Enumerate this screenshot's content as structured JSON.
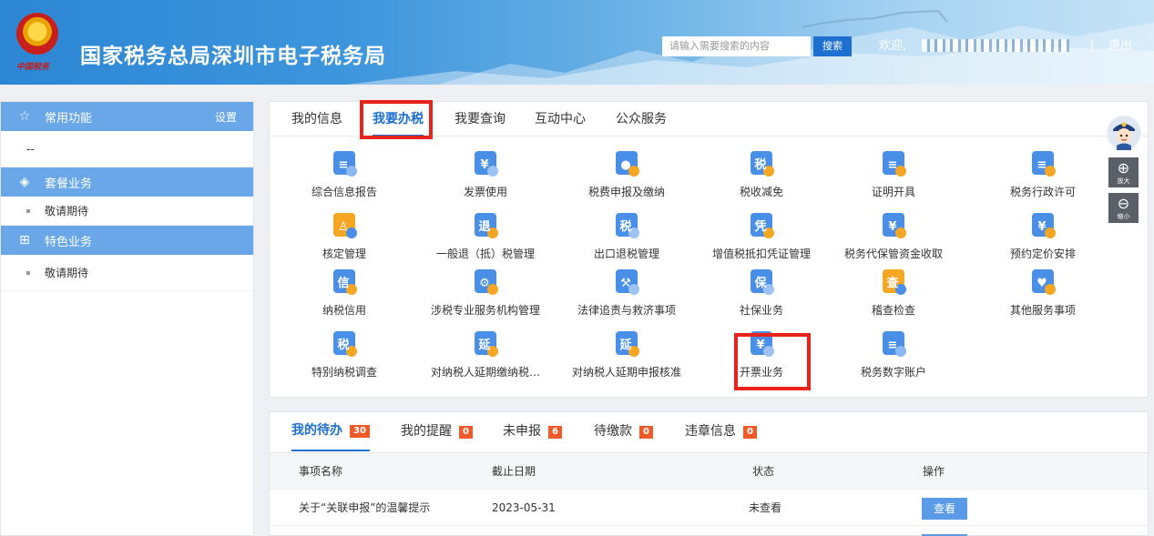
{
  "header": {
    "emblem_text": "中国税务",
    "title": "国家税务总局深圳市电子税务局",
    "search_placeholder": "请输入需要搜索的内容",
    "search_button": "搜索",
    "welcome": "欢迎,",
    "separator": "|",
    "logout": "退出"
  },
  "sidebar": {
    "sections": [
      {
        "icon": "star-icon",
        "title": "常用功能",
        "settings": "设置",
        "items": [
          "--"
        ]
      },
      {
        "icon": "layers-icon",
        "title": "套餐业务",
        "items": [
          "敬请期待"
        ]
      },
      {
        "icon": "grid-icon",
        "title": "特色业务",
        "items": [
          "敬请期待"
        ]
      }
    ]
  },
  "main_tabs": [
    "我的信息",
    "我要办税",
    "我要查询",
    "互动中心",
    "公众服务"
  ],
  "active_tab": "我要办税",
  "services": [
    {
      "label": "综合信息报告",
      "icon": "document-icon"
    },
    {
      "label": "发票使用",
      "icon": "invoice-yen-icon"
    },
    {
      "label": "税费申报及缴纳",
      "icon": "hand-coin-icon"
    },
    {
      "label": "税收减免",
      "icon": "tax-minus-icon"
    },
    {
      "label": "证明开具",
      "icon": "certificate-icon"
    },
    {
      "label": "税务行政许可",
      "icon": "license-award-icon"
    },
    {
      "label": "核定管理",
      "icon": "stamp-icon"
    },
    {
      "label": "一般退（抵）税管理",
      "icon": "refund-icon"
    },
    {
      "label": "出口退税管理",
      "icon": "export-refund-icon"
    },
    {
      "label": "增值税抵扣凭证管理",
      "icon": "voucher-icon"
    },
    {
      "label": "税务代保管资金收取",
      "icon": "fund-custody-icon"
    },
    {
      "label": "预约定价安排",
      "icon": "calendar-yen-icon"
    },
    {
      "label": "纳税信用",
      "icon": "credit-medal-icon"
    },
    {
      "label": "涉税专业服务机构管理",
      "icon": "building-gear-icon"
    },
    {
      "label": "法律追责与救济事项",
      "icon": "gavel-icon"
    },
    {
      "label": "社保业务",
      "icon": "social-insurance-icon"
    },
    {
      "label": "稽查检查",
      "icon": "inspection-shield-icon"
    },
    {
      "label": "其他服务事项",
      "icon": "heart-hands-icon"
    },
    {
      "label": "特别纳税调查",
      "icon": "special-tax-icon"
    },
    {
      "label": "对纳税人延期缴纳税…",
      "icon": "deferred-payment-icon"
    },
    {
      "label": "对纳税人延期申报核准",
      "icon": "deferred-filing-icon"
    },
    {
      "label": "开票业务",
      "icon": "invoicing-yen-icon"
    },
    {
      "label": "税务数字账户",
      "icon": "digital-account-icon"
    }
  ],
  "todo_tabs": [
    {
      "label": "我的待办",
      "count": "30"
    },
    {
      "label": "我的提醒",
      "count": "0"
    },
    {
      "label": "未申报",
      "count": "6"
    },
    {
      "label": "待缴款",
      "count": "0"
    },
    {
      "label": "违章信息",
      "count": "0"
    }
  ],
  "todo_table": {
    "columns": [
      "事项名称",
      "截止日期",
      "状态",
      "操作"
    ],
    "rows": [
      {
        "name": "关于“关联申报”的温馨提示",
        "deadline": "2023-05-31",
        "status": "未查看",
        "action": "查看"
      }
    ]
  },
  "tools": {
    "zoom_in": "放大",
    "zoom_out": "缩小"
  },
  "colors": {
    "accent": "#1d6fd0",
    "highlight_box": "#e8231c",
    "sidebar_header": "#6aa7e8",
    "badge": "#f05a28"
  }
}
